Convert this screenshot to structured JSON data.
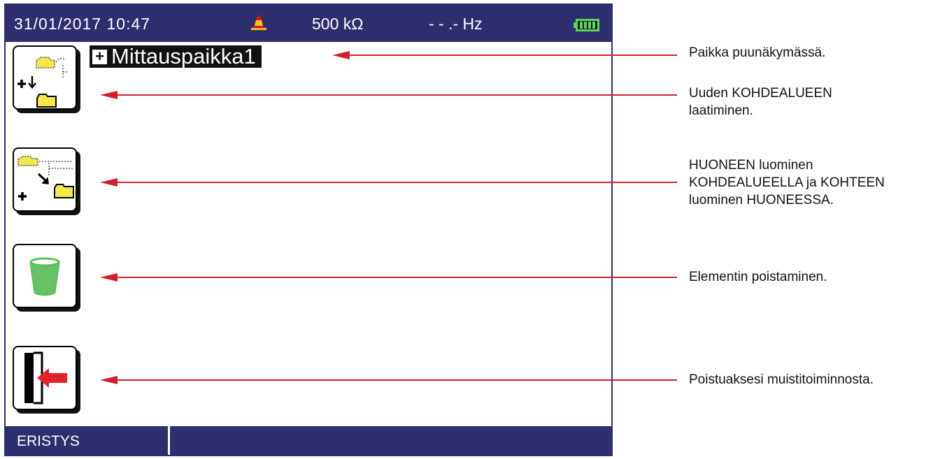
{
  "status_bar": {
    "datetime": "31/01/2017 10:47",
    "voltage": "500  kΩ",
    "frequency": "- - .-  Hz",
    "bell_icon": "alarm-bell-icon",
    "battery_icon": "battery-full-icon"
  },
  "tree": {
    "expand_symbol": "+",
    "item_label": "Mittauspaikka1"
  },
  "function_keys": [
    {
      "icon": "create-site-icon"
    },
    {
      "icon": "create-room-object-icon"
    },
    {
      "icon": "trash-bin-icon"
    },
    {
      "icon": "exit-door-icon"
    }
  ],
  "bottom_bar": {
    "mode_label": "ERISTYS"
  },
  "annotations": {
    "tree_position": "Paikka puunäkymässä.",
    "new_site_line1": "Uuden KOHDEALUEEN",
    "new_site_line2": "laatiminen.",
    "room_line1": "HUONEEN luominen",
    "room_line2": "KOHDEALUEELLA ja KOHTEEN",
    "room_line3": "luominen HUONEESSA.",
    "delete": "Elementin poistaminen.",
    "exit": "Poistuaksesi muistitoiminnosta."
  },
  "colors": {
    "bar": "#2e2e6e",
    "arrow": "#d11f2a",
    "folder": "#f4e94a",
    "trash": "#5bc25b"
  }
}
